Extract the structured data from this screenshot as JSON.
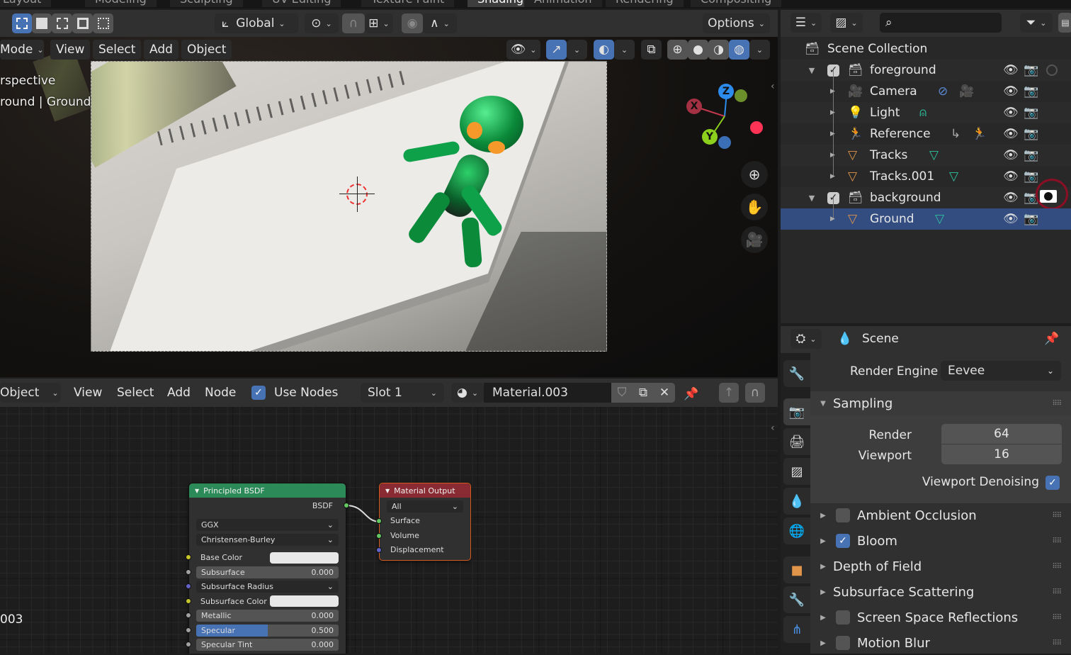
{
  "workspace_tabs": [
    "Layout",
    "Modeling",
    "Sculpting",
    "UV Editing",
    "Texture Paint",
    "Shading",
    "Animation",
    "Rendering",
    "Compositing"
  ],
  "workspace_active": "Shading",
  "viewport": {
    "transform_orientation": "Global",
    "options_label": "Options",
    "mode_label": "Mode",
    "menus": [
      "View",
      "Select",
      "Add",
      "Object"
    ],
    "overlay_text_1": "rspective",
    "overlay_text_2": "round | Ground",
    "gizmo": {
      "x": "X",
      "y": "Y",
      "z": "Z"
    },
    "colors": {
      "x": "#c4384d",
      "y": "#8ccf1d",
      "z": "#2d8ceb",
      "neg_x": "#ff3355",
      "neg_y": "#3a6fb5",
      "neg_z": "#6b8f2a"
    }
  },
  "node_editor": {
    "object_dropdown": "Object",
    "menus": [
      "View",
      "Select",
      "Add",
      "Node"
    ],
    "use_nodes_label": "Use Nodes",
    "use_nodes_checked": true,
    "slot": "Slot 1",
    "material_name": "Material.003",
    "left_text": "003",
    "principled": {
      "title": "Principled BSDF",
      "output": "BSDF",
      "distribution": "GGX",
      "subsurface_method": "Christensen-Burley",
      "rows": [
        {
          "label": "Base Color",
          "type": "color",
          "socket": "#c7c729"
        },
        {
          "label": "Subsurface",
          "value": "0.000",
          "type": "value",
          "socket": "#a1a1a1"
        },
        {
          "label": "Subsurface Radius",
          "type": "dropdown",
          "socket": "#6363c7"
        },
        {
          "label": "Subsurface Color",
          "type": "color",
          "socket": "#c7c729"
        },
        {
          "label": "Metallic",
          "value": "0.000",
          "type": "value",
          "socket": "#a1a1a1"
        },
        {
          "label": "Specular",
          "value": "0.500",
          "type": "value",
          "fill": 0.5,
          "socket": "#a1a1a1"
        },
        {
          "label": "Specular Tint",
          "value": "0.000",
          "type": "value",
          "socket": "#a1a1a1"
        }
      ],
      "header_color": "#2b8a57"
    },
    "output_node": {
      "title": "Material Output",
      "target": "All",
      "inputs": [
        "Surface",
        "Volume",
        "Displacement"
      ],
      "header_color": "#8a2b33"
    }
  },
  "outliner": {
    "root": "Scene Collection",
    "rows": [
      {
        "name": "foreground",
        "kind": "collection",
        "depth": 0,
        "expanded": true,
        "checked": true
      },
      {
        "name": "Camera",
        "kind": "camera",
        "depth": 1
      },
      {
        "name": "Light",
        "kind": "light",
        "depth": 1
      },
      {
        "name": "Reference",
        "kind": "armature",
        "depth": 1
      },
      {
        "name": "Tracks",
        "kind": "mesh",
        "depth": 1
      },
      {
        "name": "Tracks.001",
        "kind": "mesh",
        "depth": 1
      },
      {
        "name": "background",
        "kind": "collection",
        "depth": 0,
        "expanded": true,
        "checked": true,
        "holdout": true
      },
      {
        "name": "Ground",
        "kind": "mesh",
        "depth": 1,
        "selected": true
      }
    ]
  },
  "properties": {
    "context": "Scene",
    "render_engine_label": "Render Engine",
    "render_engine": "Eevee",
    "sampling": {
      "title": "Sampling",
      "render_label": "Render",
      "render_value": "64",
      "viewport_label": "Viewport",
      "viewport_value": "16",
      "denoise_label": "Viewport Denoising",
      "denoise_checked": true
    },
    "panels": [
      {
        "title": "Ambient Occlusion",
        "checkbox": true,
        "checked": false
      },
      {
        "title": "Bloom",
        "checkbox": true,
        "checked": true
      },
      {
        "title": "Depth of Field",
        "checkbox": false
      },
      {
        "title": "Subsurface Scattering",
        "checkbox": false
      },
      {
        "title": "Screen Space Reflections",
        "checkbox": true,
        "checked": false
      },
      {
        "title": "Motion Blur",
        "checkbox": true,
        "checked": false
      }
    ]
  }
}
